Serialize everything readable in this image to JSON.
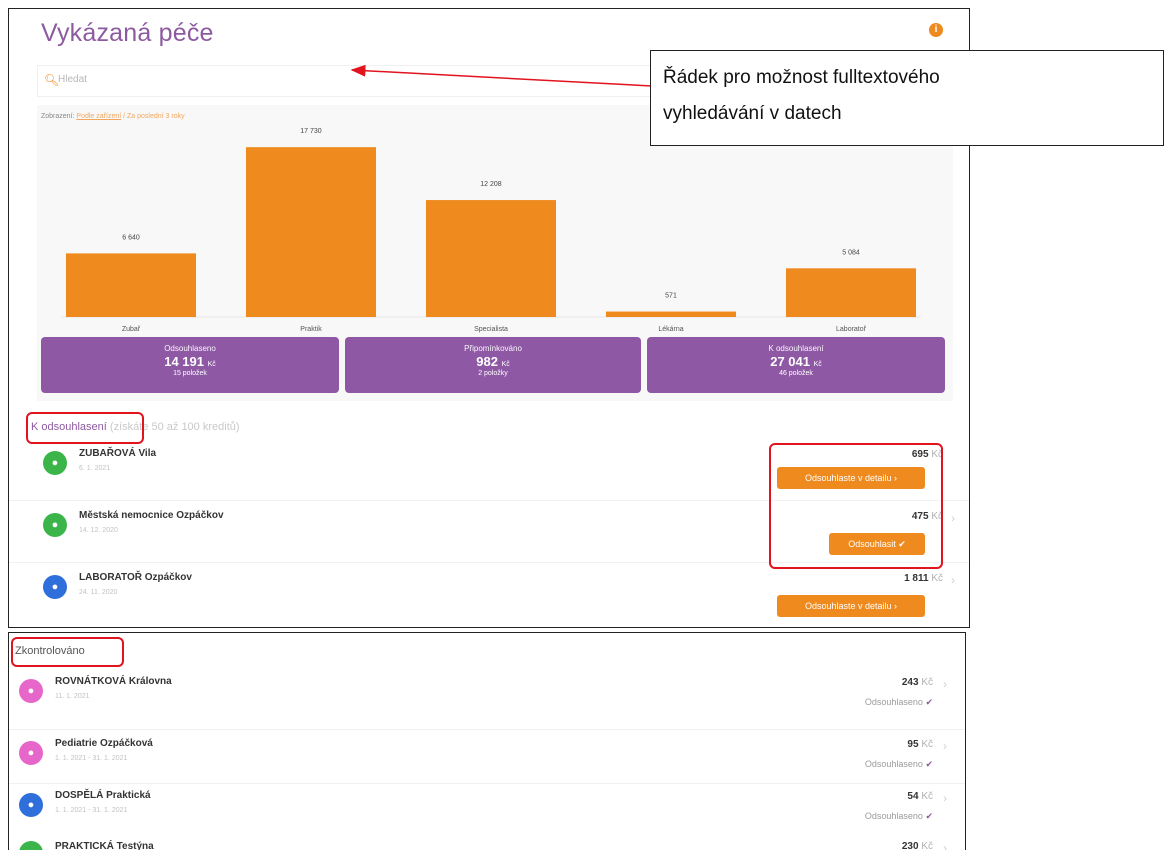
{
  "header": {
    "title": "Vykázaná péče",
    "info_glyph": "i"
  },
  "search": {
    "placeholder": "Hledat",
    "icon": "search-icon"
  },
  "breadcrumb": {
    "label": "Zobrazení:",
    "link": "Podle zařízení",
    "rest": "/ Za poslední 3 roky"
  },
  "chart_data": {
    "type": "bar",
    "categories": [
      "Zubař",
      "Praktik",
      "Specialista",
      "Lékárna",
      "Laboratoř"
    ],
    "values": [
      6640,
      17730,
      12208,
      571,
      5084
    ],
    "value_labels": [
      "6 640",
      "17 730",
      "12 208",
      "571",
      "5 084"
    ],
    "ylim": [
      0,
      19000
    ],
    "color": "#ef8a1e",
    "grid": false
  },
  "summary": [
    {
      "title": "Odsouhlaseno",
      "value": "14 191",
      "unit": "Kč",
      "count": "15 položek"
    },
    {
      "title": "Připomínkováno",
      "value": "982",
      "unit": "Kč",
      "count": "2 položky"
    },
    {
      "title": "K odsouhlasení",
      "value": "27 041",
      "unit": "Kč",
      "count": "46 položek"
    }
  ],
  "to_approve": {
    "title": "K odsouhlasení",
    "hint": "(získáte 50 až 100 kreditů)",
    "items": [
      {
        "name": "ZUBAŘOVÁ Vila",
        "date": "6. 1. 2021",
        "amount": "695",
        "unit": "Kč",
        "action": "Odsouhlaste v detailu ›",
        "icon": "tooth-icon"
      },
      {
        "name": "Městská nemocnice Ozpáčkov",
        "date": "14. 12. 2020",
        "amount": "475",
        "unit": "Kč",
        "action": "Odsouhlasit ✔",
        "icon": "tooth-icon"
      },
      {
        "name": "LABORATOŘ Ozpáčkov",
        "date": "24. 11. 2020",
        "amount": "1 811",
        "unit": "Kč",
        "action": "Odsouhlaste v detailu ›",
        "icon": "doctor-icon"
      }
    ]
  },
  "checked": {
    "title": "Zkontrolováno",
    "items": [
      {
        "name": "ROVNÁTKOVÁ Královna",
        "date": "11. 1. 2021",
        "amount": "243",
        "unit": "Kč",
        "status": "Odsouhlaseno",
        "icon": "stethoscope-icon"
      },
      {
        "name": "Pediatrie Ozpáčková",
        "date": "1. 1. 2021 - 31. 1. 2021",
        "amount": "95",
        "unit": "Kč",
        "status": "Odsouhlaseno",
        "icon": "stethoscope-icon"
      },
      {
        "name": "DOSPĚLÁ Praktická",
        "date": "1. 1. 2021 - 31. 1. 2021",
        "amount": "54",
        "unit": "Kč",
        "status": "Odsouhlaseno",
        "icon": "doctor-icon"
      },
      {
        "name": "PRAKTICKÁ Testýna",
        "date": "",
        "amount": "230",
        "unit": "Kč",
        "status": "",
        "icon": "tooth-icon"
      }
    ]
  },
  "callout": {
    "line1": "Řádek pro možnost fulltextového",
    "line2": "vyhledávání v datech"
  },
  "colors": {
    "accent": "#ef8a1e",
    "brand": "#8d5aa0",
    "annotation": "#e2131d",
    "dental": "#3bb54a",
    "lab": "#2f6fdb",
    "pink": "#e766c9"
  }
}
